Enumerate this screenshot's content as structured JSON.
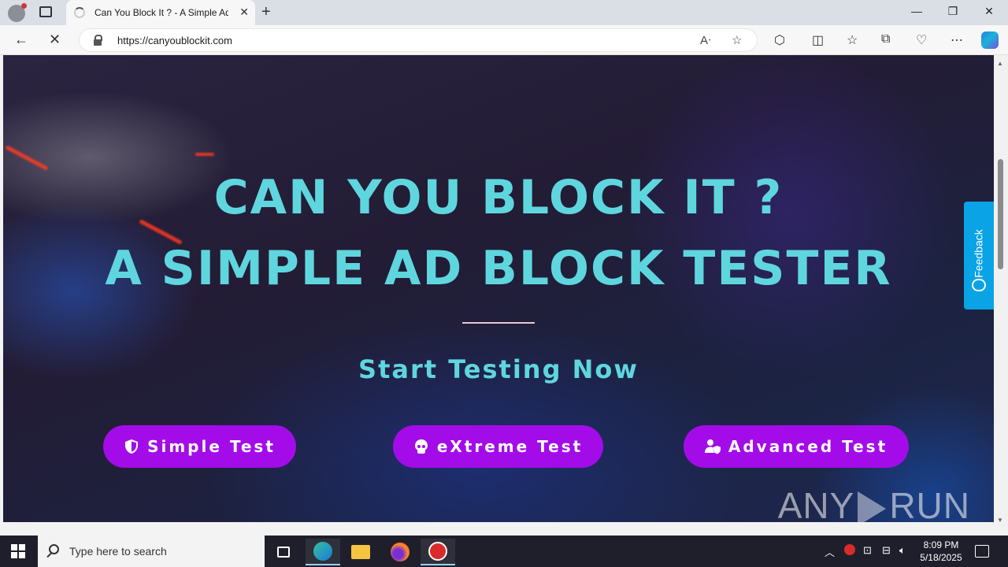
{
  "browser": {
    "tab_title": "Can You Block It ? - A Simple Ad",
    "url": "https://canyoublockit.com"
  },
  "hero": {
    "title_line1": "CAN YOU BLOCK IT ?",
    "title_line2": "A SIMPLE AD BLOCK TESTER",
    "subtitle": "Start Testing Now"
  },
  "buttons": {
    "simple": "Simple Test",
    "extreme": "eXtreme Test",
    "advanced": "Advanced Test"
  },
  "feedback_label": "Feedback",
  "watermark": {
    "left": "ANY",
    "right": "RUN"
  },
  "taskbar": {
    "search_placeholder": "Type here to search",
    "time": "8:09 PM",
    "date": "5/18/2025"
  },
  "colors": {
    "title": "#5fd6de",
    "button": "#a30ce8",
    "feedback": "#0aa3e6"
  }
}
